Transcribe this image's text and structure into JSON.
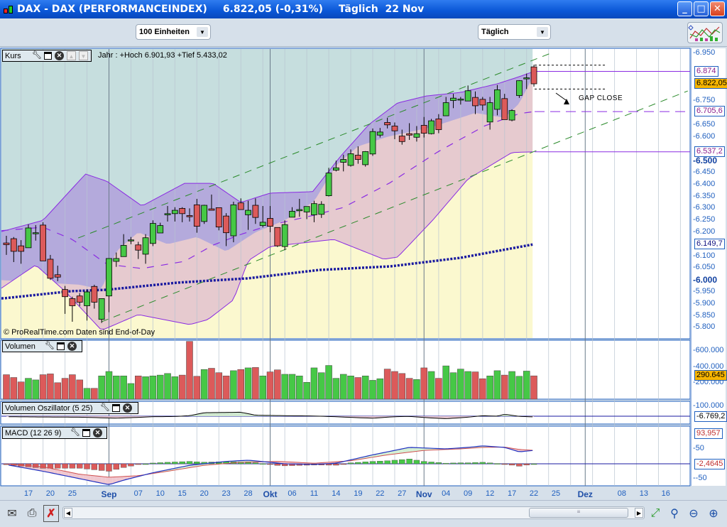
{
  "window": {
    "instrument": "DAX - DAX (PERFORMANCEINDEX)",
    "price": "6.822,05 (-0,31%)",
    "period": "Täglich",
    "date": "22 Nov",
    "buttons": {
      "minimize": "_",
      "maximize": "□",
      "close": "✕"
    }
  },
  "toolbar": {
    "units_select": "100 Einheiten",
    "interval_select": "Täglich",
    "indicator_button_icon": "indicators-icon"
  },
  "price_panel": {
    "title": "Kurs",
    "info": "Jahr : +Hoch 6.901,93 +Tief 5.433,02",
    "copyright": "© ProRealTime.com  Daten sind End-of-Day",
    "annotation": "GAP CLOSE",
    "axis_ticks": [
      {
        "v": 6950,
        "t": "6.950"
      },
      {
        "v": 6750,
        "t": "6.750"
      },
      {
        "v": 6650,
        "t": "6.650"
      },
      {
        "v": 6600,
        "t": "6.600"
      },
      {
        "v": 6500,
        "t": "6.500",
        "bold": true
      },
      {
        "v": 6450,
        "t": "6.450"
      },
      {
        "v": 6400,
        "t": "6.400"
      },
      {
        "v": 6350,
        "t": "6.350"
      },
      {
        "v": 6300,
        "t": "6.300"
      },
      {
        "v": 6250,
        "t": "6.250"
      },
      {
        "v": 6200,
        "t": "6.200"
      },
      {
        "v": 6100,
        "t": "6.100"
      },
      {
        "v": 6050,
        "t": "6.050"
      },
      {
        "v": 6000,
        "t": "6.000",
        "bold": true
      },
      {
        "v": 5950,
        "t": "5.950"
      },
      {
        "v": 5900,
        "t": "5.900"
      },
      {
        "v": 5850,
        "t": "5.850"
      },
      {
        "v": 5800,
        "t": "5.800"
      }
    ],
    "value_labels": [
      {
        "v": 6874,
        "t": "6.874",
        "color": "#8a1a8a",
        "bg": "#ffffff"
      },
      {
        "v": 6822.05,
        "t": "6.822,05",
        "color": "#000000",
        "bg": "#f7b500"
      },
      {
        "v": 6705.6,
        "t": "6.705,6",
        "color": "#8a1a8a",
        "bg": "#ffffff"
      },
      {
        "v": 6537.2,
        "t": "6.537,2",
        "color": "#8a1a8a",
        "bg": "#ffffff"
      },
      {
        "v": 6149.7,
        "t": "6.149,7",
        "color": "#101080",
        "bg": "#ffffff"
      }
    ]
  },
  "volume_panel": {
    "title": "Volumen",
    "axis_ticks": [
      {
        "v": 600,
        "t": "600.000"
      },
      {
        "v": 400,
        "t": "400.000"
      },
      {
        "v": 200,
        "t": "200.000"
      }
    ],
    "value_label": {
      "v": 290.645,
      "t": "290.645",
      "bg": "#f7b500"
    }
  },
  "volosc_panel": {
    "title": "Volumen Oszillator (5 25)",
    "axis_ticks": [
      {
        "v": 100,
        "t": "100.000"
      }
    ],
    "value_label": {
      "v": -6.769,
      "t": "-6.769,2"
    }
  },
  "macd_panel": {
    "title": "MACD (12 26 9)",
    "axis_ticks": [
      {
        "v": 50,
        "t": "50"
      },
      {
        "v": -50,
        "t": "-50"
      }
    ],
    "value_labels": [
      {
        "v": 93.957,
        "t": "93,957",
        "color": "#c03030"
      },
      {
        "v": -2.4645,
        "t": "-2,4645",
        "color": "#c03030"
      }
    ]
  },
  "x_axis": {
    "labels": [
      {
        "i": 3,
        "t": "17"
      },
      {
        "i": 6,
        "t": "20"
      },
      {
        "i": 9,
        "t": "25"
      },
      {
        "i": 14,
        "t": "Sep",
        "month": true
      },
      {
        "i": 18,
        "t": "07"
      },
      {
        "i": 21,
        "t": "10"
      },
      {
        "i": 24,
        "t": "15"
      },
      {
        "i": 27,
        "t": "20"
      },
      {
        "i": 30,
        "t": "23"
      },
      {
        "i": 33,
        "t": "28"
      },
      {
        "i": 36,
        "t": "Okt",
        "month": true
      },
      {
        "i": 39,
        "t": "06"
      },
      {
        "i": 42,
        "t": "11"
      },
      {
        "i": 45,
        "t": "14"
      },
      {
        "i": 48,
        "t": "19"
      },
      {
        "i": 51,
        "t": "22"
      },
      {
        "i": 54,
        "t": "27"
      },
      {
        "i": 57,
        "t": "Nov",
        "month": true
      },
      {
        "i": 60,
        "t": "04"
      },
      {
        "i": 63,
        "t": "09"
      },
      {
        "i": 66,
        "t": "12"
      },
      {
        "i": 69,
        "t": "17"
      },
      {
        "i": 72,
        "t": "22"
      },
      {
        "i": 75,
        "t": "25"
      },
      {
        "i": 79,
        "t": "Dez",
        "month": true
      },
      {
        "i": 84,
        "t": "08"
      },
      {
        "i": 87,
        "t": "13"
      },
      {
        "i": 90,
        "t": "16"
      }
    ]
  },
  "bottom_toolbar": {
    "icons": [
      "mail-icon",
      "print-icon",
      "disconnect-icon",
      "zoom-fit-icon",
      "zoom-auto-icon",
      "zoom-out-icon",
      "zoom-in-icon"
    ],
    "scroll_grip": "≡"
  },
  "colors": {
    "up": "#46c846",
    "down": "#dc5a5a",
    "upper_zone": "#c6dede",
    "band": "#e6cacf",
    "band_top": "#b4aadc",
    "lower_zone": "#fbf8cf",
    "band_line": "#8a2be2",
    "ma200": "#1a1aa0",
    "channel": "#2a8a2a",
    "accent": "#1f5fbf"
  },
  "chart_data": {
    "type": "candlestick",
    "title": "DAX - DAX (PERFORMANCEINDEX)",
    "ohlc_fields": [
      "open",
      "high",
      "low",
      "close"
    ],
    "candles": [
      [
        6155,
        6185,
        6105,
        6148
      ],
      [
        6173,
        6180,
        6075,
        6120
      ],
      [
        6143,
        6167,
        6068,
        6120
      ],
      [
        6135,
        6233,
        6135,
        6218
      ],
      [
        6195,
        6230,
        6165,
        6198
      ],
      [
        6230,
        6242,
        6080,
        6080
      ],
      [
        6087,
        6105,
        6000,
        6007
      ],
      [
        6022,
        6060,
        5995,
        6012
      ],
      [
        5960,
        5975,
        5858,
        5930
      ],
      [
        5922,
        5930,
        5825,
        5892
      ],
      [
        5933,
        5945,
        5890,
        5907
      ],
      [
        5892,
        5960,
        5830,
        5950
      ],
      [
        5973,
        5980,
        5880,
        5907
      ],
      [
        5835,
        5922,
        5820,
        5922
      ],
      [
        5933,
        6090,
        5865,
        6090
      ],
      [
        6078,
        6115,
        6055,
        6090
      ],
      [
        6098,
        6192,
        6098,
        6145
      ],
      [
        6167,
        6180,
        6150,
        6168
      ],
      [
        6147,
        6160,
        6088,
        6125
      ],
      [
        6108,
        6192,
        6068,
        6177
      ],
      [
        6153,
        6250,
        6142,
        6237
      ],
      [
        6197,
        6240,
        6197,
        6228
      ],
      [
        6273,
        6310,
        6245,
        6278
      ],
      [
        6278,
        6305,
        6245,
        6292
      ],
      [
        6300,
        6305,
        6242,
        6278
      ],
      [
        6270,
        6300,
        6245,
        6265
      ],
      [
        6315,
        6340,
        6198,
        6225
      ],
      [
        6245,
        6315,
        6235,
        6313
      ],
      [
        6298,
        6358,
        6292,
        6292
      ],
      [
        6303,
        6303,
        6208,
        6222
      ],
      [
        6268,
        6280,
        6142,
        6198
      ],
      [
        6185,
        6328,
        6158,
        6315
      ],
      [
        6323,
        6342,
        6295,
        6295
      ],
      [
        6273,
        6332,
        6210,
        6292
      ],
      [
        6313,
        6342,
        6235,
        6262
      ],
      [
        6228,
        6310,
        6220,
        6242
      ],
      [
        6258,
        6310,
        6200,
        6225
      ],
      [
        6220,
        6220,
        6138,
        6143
      ],
      [
        6140,
        6250,
        6125,
        6232
      ],
      [
        6263,
        6305,
        6263,
        6288
      ],
      [
        6290,
        6340,
        6265,
        6295
      ],
      [
        6285,
        6308,
        6255,
        6308
      ],
      [
        6273,
        6332,
        6242,
        6320
      ],
      [
        6275,
        6330,
        6260,
        6317
      ],
      [
        6353,
        6470,
        6350,
        6448
      ],
      [
        6460,
        6500,
        6455,
        6470
      ],
      [
        6493,
        6525,
        6455,
        6505
      ],
      [
        6480,
        6547,
        6475,
        6529
      ],
      [
        6523,
        6560,
        6487,
        6505
      ],
      [
        6483,
        6540,
        6475,
        6538
      ],
      [
        6528,
        6635,
        6520,
        6622
      ],
      [
        6607,
        6637,
        6597,
        6620
      ],
      [
        6660,
        6680,
        6635,
        6650
      ],
      [
        6645,
        6660,
        6590,
        6625
      ],
      [
        6603,
        6630,
        6567,
        6580
      ],
      [
        6613,
        6657,
        6587,
        6607
      ],
      [
        6598,
        6645,
        6580,
        6613
      ],
      [
        6648,
        6683,
        6597,
        6615
      ],
      [
        6613,
        6675,
        6610,
        6667
      ],
      [
        6675,
        6695,
        6615,
        6630
      ],
      [
        6688,
        6767,
        6688,
        6743
      ],
      [
        6752,
        6780,
        6720,
        6762
      ],
      [
        6757,
        6767,
        6735,
        6758
      ],
      [
        6750,
        6815,
        6750,
        6793
      ],
      [
        6765,
        6790,
        6695,
        6730
      ],
      [
        6757,
        6767,
        6710,
        6733
      ],
      [
        6662,
        6767,
        6630,
        6743
      ],
      [
        6715,
        6817,
        6690,
        6797
      ],
      [
        6760,
        6780,
        6672,
        6672
      ],
      [
        6670,
        6715,
        6665,
        6710
      ],
      [
        6773,
        6837,
        6763,
        6835
      ],
      [
        6843,
        6865,
        6800,
        6847
      ],
      [
        6893,
        6901.93,
        6810,
        6822.05
      ]
    ],
    "volume_k": [
      305,
      270,
      215,
      260,
      240,
      305,
      315,
      205,
      260,
      305,
      240,
      135,
      135,
      290,
      345,
      290,
      290,
      195,
      290,
      280,
      290,
      300,
      320,
      280,
      300,
      720,
      285,
      370,
      385,
      330,
      290,
      355,
      370,
      390,
      395,
      290,
      340,
      365,
      310,
      310,
      290,
      210,
      390,
      330,
      420,
      260,
      310,
      290,
      270,
      290,
      235,
      255,
      375,
      345,
      320,
      260,
      245,
      390,
      345,
      260,
      415,
      330,
      375,
      345,
      340,
      255,
      290,
      355,
      300,
      345,
      285,
      350,
      290.645
    ],
    "bollinger_upper": [
      [
        -1,
        6200
      ],
      [
        5,
        6250
      ],
      [
        10.8,
        6444
      ],
      [
        13.7,
        6414
      ],
      [
        18.5,
        6310
      ],
      [
        24.3,
        6405
      ],
      [
        28.2,
        6405
      ],
      [
        32,
        6325
      ],
      [
        36,
        6364
      ],
      [
        41.8,
        6370
      ],
      [
        45.6,
        6518
      ],
      [
        49.5,
        6652
      ],
      [
        53.4,
        6742
      ],
      [
        57.3,
        6771
      ],
      [
        62,
        6786
      ],
      [
        67,
        6822
      ],
      [
        70,
        6852
      ],
      [
        72,
        6874
      ]
    ],
    "bollinger_mid": [
      [
        -1,
        6206
      ],
      [
        5,
        6221
      ],
      [
        9,
        6170
      ],
      [
        13.7,
        6066
      ],
      [
        18.5,
        6048
      ],
      [
        24.3,
        6078
      ],
      [
        28.2,
        6146
      ],
      [
        32,
        6191
      ],
      [
        36,
        6230
      ],
      [
        41.8,
        6270
      ],
      [
        46,
        6304
      ],
      [
        52.4,
        6408
      ],
      [
        59,
        6539
      ],
      [
        65.3,
        6646
      ],
      [
        70,
        6697
      ],
      [
        72,
        6705.6
      ]
    ],
    "bollinger_lower": [
      [
        -1,
        5959
      ],
      [
        4,
        6063
      ],
      [
        8,
        5953
      ],
      [
        13,
        5789
      ],
      [
        18,
        5855
      ],
      [
        25,
        5813
      ],
      [
        27.5,
        5834
      ],
      [
        31,
        5917
      ],
      [
        33,
        6081
      ],
      [
        36,
        6140
      ],
      [
        44.7,
        6170
      ],
      [
        51.5,
        6087
      ],
      [
        53.4,
        6096
      ],
      [
        58.2,
        6251
      ],
      [
        63,
        6423
      ],
      [
        69,
        6534
      ],
      [
        72,
        6537.2
      ]
    ],
    "band_top_fill_floor": [
      [
        -1,
        6000
      ],
      [
        10,
        5980
      ],
      [
        13,
        5960
      ],
      [
        15,
        6120
      ],
      [
        18,
        6200
      ],
      [
        22,
        6150
      ],
      [
        26,
        6180
      ],
      [
        30,
        6120
      ],
      [
        34,
        6200
      ],
      [
        38,
        6250
      ],
      [
        42,
        6330
      ],
      [
        45,
        6480
      ],
      [
        48,
        6560
      ],
      [
        52,
        6600
      ],
      [
        58,
        6640
      ],
      [
        64,
        6700
      ],
      [
        68,
        6680
      ],
      [
        70,
        6740
      ],
      [
        72,
        6860
      ]
    ],
    "ma200": [
      [
        -0.4,
        5923
      ],
      [
        8.8,
        5953
      ],
      [
        13.7,
        5959
      ],
      [
        23.4,
        5989
      ],
      [
        33,
        6007
      ],
      [
        42.7,
        6042
      ],
      [
        52.4,
        6057
      ],
      [
        62,
        6093
      ],
      [
        72,
        6149.7
      ]
    ],
    "channel_upper": [
      [
        9.8,
        6176
      ],
      [
        74.7,
        6955
      ]
    ],
    "channel_lower": [
      [
        13,
        5825
      ],
      [
        93,
        6792
      ]
    ],
    "hlines": [
      {
        "v": 6874,
        "style": "solid"
      },
      {
        "v": 6705.6,
        "style": "dashed"
      },
      {
        "v": 6537.2,
        "style": "solid"
      },
      {
        "v": 6900,
        "style": "dotted"
      },
      {
        "v": 6800,
        "style": "dotted"
      }
    ],
    "volume_oscillator": [
      [
        0,
        -5
      ],
      [
        5,
        -8
      ],
      [
        10,
        -10
      ],
      [
        15,
        -20
      ],
      [
        18,
        -12
      ],
      [
        20,
        -5
      ],
      [
        23,
        -3
      ],
      [
        25,
        5
      ],
      [
        27,
        35
      ],
      [
        30,
        38
      ],
      [
        32,
        40
      ],
      [
        34,
        10
      ],
      [
        38,
        5
      ],
      [
        42,
        2
      ],
      [
        45,
        -5
      ],
      [
        48,
        -15
      ],
      [
        50,
        -20
      ],
      [
        53,
        -5
      ],
      [
        55,
        -2
      ],
      [
        58,
        -18
      ],
      [
        60,
        -25
      ],
      [
        63,
        -10
      ],
      [
        65,
        5
      ],
      [
        67,
        0
      ],
      [
        68,
        20
      ],
      [
        70,
        -2
      ],
      [
        72,
        -6.769
      ]
    ],
    "macd": [
      [
        0,
        -3
      ],
      [
        5,
        -25
      ],
      [
        10,
        -50
      ],
      [
        14,
        -70
      ],
      [
        16,
        -55
      ],
      [
        20,
        -30
      ],
      [
        25,
        -5
      ],
      [
        30,
        8
      ],
      [
        33,
        12
      ],
      [
        36,
        5
      ],
      [
        38,
        0
      ],
      [
        42,
        -2
      ],
      [
        45,
        2
      ],
      [
        50,
        30
      ],
      [
        55,
        55
      ],
      [
        60,
        50
      ],
      [
        63,
        55
      ],
      [
        65,
        60
      ],
      [
        68,
        55
      ],
      [
        70,
        40
      ],
      [
        72,
        45
      ]
    ],
    "macd_signal": [
      [
        0,
        0
      ],
      [
        5,
        -10
      ],
      [
        10,
        -35
      ],
      [
        14,
        -45
      ],
      [
        18,
        -40
      ],
      [
        22,
        -25
      ],
      [
        27,
        -5
      ],
      [
        32,
        5
      ],
      [
        37,
        8
      ],
      [
        42,
        2
      ],
      [
        47,
        10
      ],
      [
        52,
        30
      ],
      [
        57,
        45
      ],
      [
        62,
        50
      ],
      [
        65,
        55
      ],
      [
        68,
        56
      ],
      [
        70,
        48
      ],
      [
        72,
        45
      ]
    ],
    "ylim_price": [
      5800,
      6950
    ],
    "ylim_volume_k": [
      0,
      700
    ],
    "x_range_index": [
      -1,
      93
    ]
  }
}
